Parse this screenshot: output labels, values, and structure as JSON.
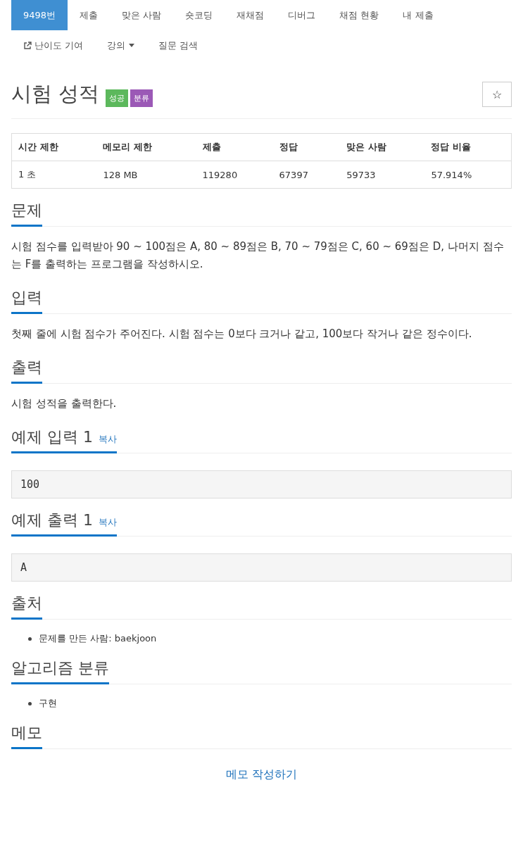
{
  "tabs": [
    {
      "label": "9498번",
      "selected": true,
      "kind": "plain"
    },
    {
      "label": "제출",
      "selected": false,
      "kind": "plain"
    },
    {
      "label": "맞은 사람",
      "selected": false,
      "kind": "plain"
    },
    {
      "label": "숏코딩",
      "selected": false,
      "kind": "plain"
    },
    {
      "label": "재채점",
      "selected": false,
      "kind": "plain"
    },
    {
      "label": "디버그",
      "selected": false,
      "kind": "plain"
    },
    {
      "label": "채점 현황",
      "selected": false,
      "kind": "plain"
    },
    {
      "label": "내 제출",
      "selected": false,
      "kind": "plain"
    },
    {
      "label": "난이도 기여",
      "selected": false,
      "kind": "external"
    },
    {
      "label": "강의",
      "selected": false,
      "kind": "dropdown"
    },
    {
      "label": "질문 검색",
      "selected": false,
      "kind": "plain"
    }
  ],
  "title": "시험 성적",
  "badges": [
    {
      "label": "성공",
      "color": "#5cb85c"
    },
    {
      "label": "분류",
      "color": "#9b59b6"
    }
  ],
  "star_button": {
    "label": "☆"
  },
  "stats": {
    "columns": [
      "시간 제한",
      "메모리 제한",
      "제출",
      "정답",
      "맞은 사람",
      "정답 비율"
    ],
    "row": [
      "1 초",
      "128 MB",
      "119280",
      "67397",
      "59733",
      "57.914%"
    ]
  },
  "sections": [
    {
      "heading": "문제",
      "kind": "text",
      "text": "시험 점수를 입력받아 90 ~ 100점은 A, 80 ~ 89점은 B, 70 ~ 79점은 C, 60 ~ 69점은 D, 나머지 점수는 F를 출력하는 프로그램을 작성하시오."
    },
    {
      "heading": "입력",
      "kind": "text",
      "text": "첫째 줄에 시험 점수가 주어진다. 시험 점수는 0보다 크거나 같고, 100보다 작거나 같은 정수이다."
    },
    {
      "heading": "출력",
      "kind": "text",
      "text": "시험 성적을 출력한다."
    },
    {
      "heading": "예제 입력 1",
      "copy": "복사",
      "kind": "code",
      "text": "100"
    },
    {
      "heading": "예제 출력 1",
      "copy": "복사",
      "kind": "code",
      "text": "A"
    },
    {
      "heading": "출처",
      "kind": "list",
      "items": [
        "문제를 만든 사람: baekjoon"
      ]
    },
    {
      "heading": "알고리즘 분류",
      "kind": "list",
      "items": [
        "구현"
      ]
    },
    {
      "heading": "메모",
      "kind": "link",
      "text": "메모 작성하기"
    }
  ]
}
